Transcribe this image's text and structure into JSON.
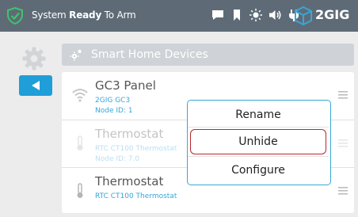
{
  "status_bar": {
    "prefix": "System ",
    "emphasis": "Ready",
    "suffix": " To Arm",
    "brand": "2GIG",
    "icons": [
      "chat-icon",
      "bookmark-icon",
      "brightness-icon",
      "volume-icon",
      "power-plug-icon"
    ]
  },
  "header": {
    "title": "Smart Home Devices",
    "icon": "smart-home-icon"
  },
  "devices": [
    {
      "name": "GC3 Panel",
      "model": "2GIG GC3",
      "node": "Node ID: 1",
      "icon": "wifi-icon",
      "faded": false
    },
    {
      "name": "Thermostat",
      "model": "RTC CT100 Thermostat",
      "node": "Node ID: 7.0",
      "icon": "thermometer-icon",
      "faded": true
    },
    {
      "name": "Thermostat",
      "model": "RTC CT100 Thermostat",
      "node": "",
      "icon": "thermometer-icon",
      "faded": false
    }
  ],
  "context_menu": {
    "items": [
      "Rename",
      "Unhide",
      "Configure"
    ],
    "selected": "Unhide"
  },
  "colors": {
    "status_bar": "#5e6b76",
    "accent": "#1f9ed8",
    "link": "#38a5d9",
    "selection": "#b8272d",
    "shield": "#3ec46d"
  }
}
